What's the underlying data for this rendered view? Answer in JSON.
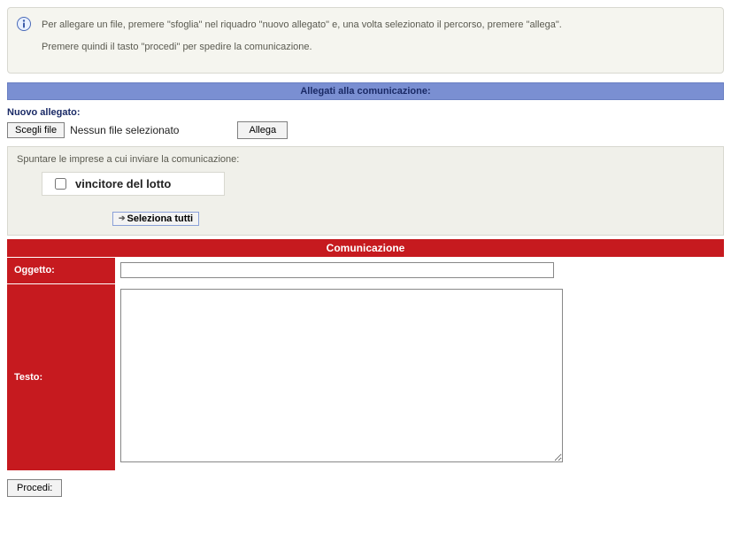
{
  "info": {
    "line1": "Per allegare un file, premere \"sfoglia\" nel riquadro \"nuovo allegato\" e, una volta selezionato il percorso, premere \"allega\".",
    "line2": "Premere quindi il tasto \"procedi\" per spedire la comunicazione."
  },
  "attachments": {
    "section_title": "Allegati alla comunicazione:",
    "new_label": "Nuovo allegato:",
    "choose_file_label": "Scegli file",
    "file_status": "Nessun file selezionato",
    "attach_btn": "Allega"
  },
  "recipients": {
    "instruction": "Spuntare le imprese a cui inviare la comunicazione:",
    "company": "vincitore del lotto",
    "select_all": "Seleziona tutti"
  },
  "communication": {
    "header": "Comunicazione",
    "subject_label": "Oggetto:",
    "subject_value": "",
    "body_label": "Testo:",
    "body_value": ""
  },
  "actions": {
    "proceed": "Procedi:"
  }
}
